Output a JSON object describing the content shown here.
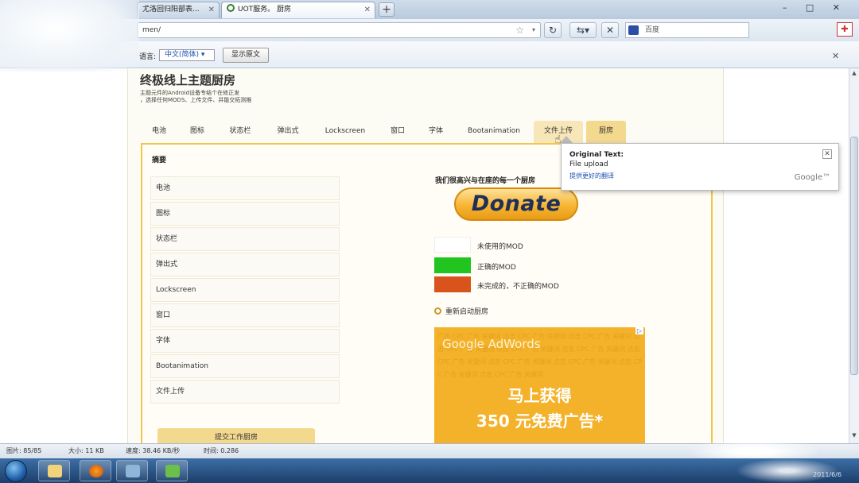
{
  "browser": {
    "tabs": [
      {
        "label": "尤洛回归阳部表...",
        "active": false
      },
      {
        "label": "UOT服务。 厨房",
        "active": true
      }
    ],
    "url": "men/",
    "search_placeholder": "百度",
    "window_controls": "– □ ✕"
  },
  "translate_bar": {
    "label": "语言:",
    "language": "中文(简体) ▾",
    "show_original": "显示原文"
  },
  "page": {
    "site_title": "终极线上主题厨房",
    "subtitle_1": "主题元件的Android设备专结个在修正发",
    "subtitle_2": "，选择任何MODS、上传文件、并能交拓测推",
    "tabs": [
      "电池",
      "图标",
      "状态栏",
      "弹出式",
      "Lockscreen",
      "窗口",
      "字体",
      "Bootanimation",
      "文件上传",
      "厨房"
    ],
    "content_title": "摘要",
    "list_items": [
      "电池",
      "图标",
      "状态栏",
      "弹出式",
      "Lockscreen",
      "窗口",
      "字体",
      "Bootanimation",
      "文件上传"
    ],
    "submit_button": "提交工作厨房",
    "donate_text": "我们很高兴与在座的每一个厨房",
    "donate_button": "Donate",
    "legend": [
      {
        "label": "未使用的MOD",
        "color": "#ffffff"
      },
      {
        "label": "正确的MOD",
        "color": "#22c41f"
      },
      {
        "label": "未完成的，不正确的MOD",
        "color": "#d8541c"
      }
    ],
    "manage_link": "重新启动厨房",
    "ad": {
      "brand": "Google AdWords",
      "line1": "马上获得",
      "line2": "350 元免费广告*",
      "adchoices": "▷"
    }
  },
  "popup": {
    "title": "Original Text:",
    "original": "File upload",
    "link": "提供更好的翻译",
    "google": "Google™"
  },
  "status_bar": {
    "images": "图片: 85/85",
    "size": "大小: 11 KB",
    "speed": "速度: 38.46 KB/秒",
    "time": "时间: 0.286"
  },
  "taskbar": {
    "clock": "2011/6/6"
  }
}
